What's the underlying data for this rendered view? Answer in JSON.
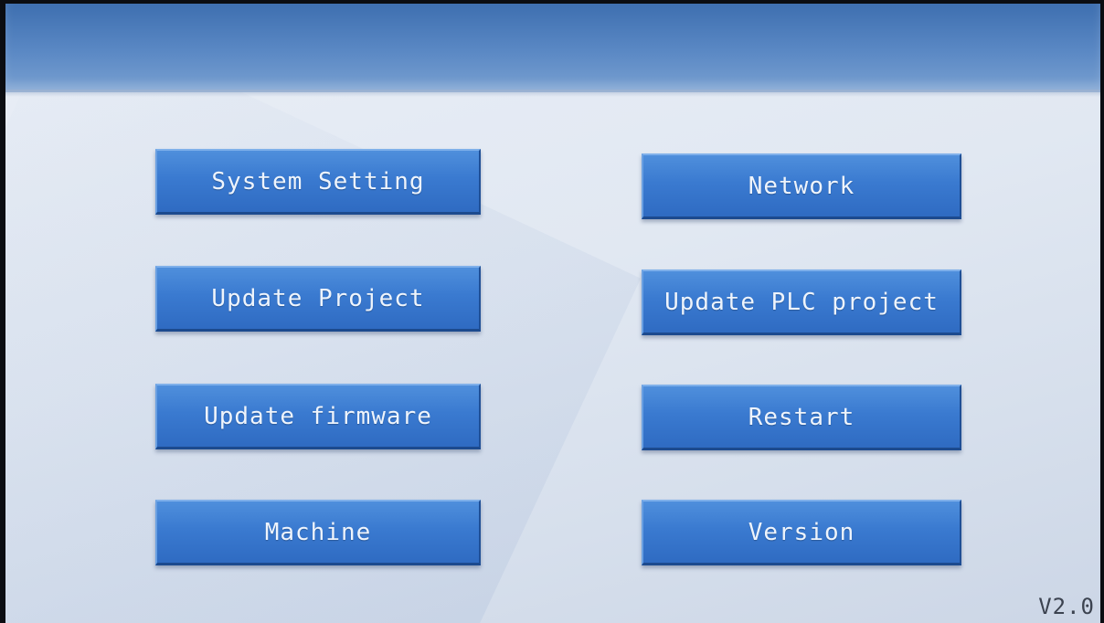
{
  "menu": {
    "system_setting": "System Setting",
    "network": "Network",
    "update_project": "Update Project",
    "update_plc_project": "Update PLC project",
    "update_firmware": "Update firmware",
    "restart": "Restart",
    "machine": "Machine",
    "version": "Version"
  },
  "footer": {
    "version_text": "V2.0"
  },
  "colors": {
    "button_blue": "#3a7ad0",
    "header_blue": "#4f7fbe",
    "background": "#e1e8f2"
  }
}
